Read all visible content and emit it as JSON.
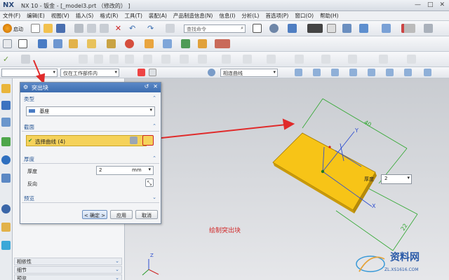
{
  "window": {
    "logo": "NX",
    "title": "NX 10 - 钣金 - [_model3.prt （修改的） ]",
    "controls": [
      "—",
      "□",
      "✕"
    ]
  },
  "menu": [
    "文件(F)",
    "编辑(E)",
    "视图(V)",
    "插入(S)",
    "格式(R)",
    "工具(T)",
    "装配(A)",
    "产品制造信息(N)",
    "信息(I)",
    "分析(L)",
    "首选项(P)",
    "窗口(O)",
    "帮助(H)"
  ],
  "toolbar": {
    "start_label": "启动",
    "search_placeholder": "查找命令",
    "filter_value": "仅在工作部件内",
    "curve_rule": "相连曲线"
  },
  "dialog": {
    "title": "突出块",
    "type_section": "类型",
    "type_value": "基座",
    "section_header": "截面",
    "select_curve": "选择曲线 (4)",
    "thickness_section": "厚度",
    "thickness_label": "厚度",
    "thickness_value": "2",
    "thickness_unit": "mm",
    "reverse_label": "反向",
    "preview_section": "预览",
    "ok_label": "< 确定 >",
    "apply_label": "应用",
    "cancel_label": "取消"
  },
  "navigator": {
    "rows": [
      "相依性",
      "细节",
      "预览"
    ]
  },
  "viewport": {
    "thickness_callout_label": "厚度",
    "thickness_callout_value": "2",
    "dim_top": "40",
    "dim_bottom": "22",
    "axis_x": "X",
    "axis_y": "Y",
    "axis_z": "Z",
    "annotation": "绘制突出块"
  },
  "watermark": {
    "brand": "资料网",
    "url": "ZL.XS1616.COM"
  },
  "colors": {
    "part_fill": "#f7c417",
    "highlight": "#f5d25a",
    "accent": "#3d6db0",
    "annotation": "#d12a2a"
  }
}
